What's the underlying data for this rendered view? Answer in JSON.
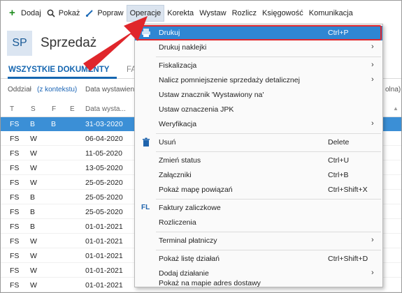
{
  "toolbar": {
    "items": [
      {
        "label": "Dodaj",
        "icon": "plus-icon"
      },
      {
        "label": "Pokaż",
        "icon": "search-icon"
      },
      {
        "label": "Popraw",
        "icon": "brush-icon"
      },
      {
        "label": "Operacje",
        "icon": ""
      },
      {
        "label": "Korekta",
        "icon": ""
      },
      {
        "label": "Wystaw",
        "icon": ""
      },
      {
        "label": "Rozlicz",
        "icon": ""
      },
      {
        "label": "Księgowość",
        "icon": ""
      },
      {
        "label": "Komunikacja",
        "icon": ""
      }
    ]
  },
  "header": {
    "badge": "SP",
    "title": "Sprzedaż"
  },
  "tabs": {
    "active": "WSZYSTKIE DOKUMENTY",
    "next": "FA"
  },
  "filters": {
    "oddzial": "Oddział",
    "kontekst": "(z kontekstu)",
    "data": "Data wystawien",
    "right": "olna)"
  },
  "grid": {
    "headers": {
      "t": "T",
      "s": "S",
      "f": "F",
      "e": "E",
      "date": "Data wysta..."
    },
    "rows": [
      {
        "t": "FS",
        "s": "B",
        "f": "B",
        "date": "31-03-2020",
        "selected": true
      },
      {
        "t": "FS",
        "s": "W",
        "f": "",
        "date": "06-04-2020"
      },
      {
        "t": "FS",
        "s": "W",
        "f": "",
        "date": "11-05-2020"
      },
      {
        "t": "FS",
        "s": "W",
        "f": "",
        "date": "13-05-2020"
      },
      {
        "t": "FS",
        "s": "W",
        "f": "",
        "date": "25-05-2020"
      },
      {
        "t": "FS",
        "s": "B",
        "f": "",
        "date": "25-05-2020"
      },
      {
        "t": "FS",
        "s": "B",
        "f": "",
        "date": "25-05-2020"
      },
      {
        "t": "FS",
        "s": "B",
        "f": "",
        "date": "01-01-2021"
      },
      {
        "t": "FS",
        "s": "W",
        "f": "",
        "date": "01-01-2021"
      },
      {
        "t": "FS",
        "s": "W",
        "f": "",
        "date": "01-01-2021"
      },
      {
        "t": "FS",
        "s": "W",
        "f": "",
        "date": "01-01-2021"
      },
      {
        "t": "FS",
        "s": "W",
        "f": "",
        "date": "01-01-2021"
      }
    ]
  },
  "menu": {
    "items": [
      {
        "label": "Drukuj",
        "shortcut": "Ctrl+P",
        "icon": "printer-icon",
        "highlight": true
      },
      {
        "label": "Drukuj naklejki",
        "submenu": true
      },
      {
        "sep": true
      },
      {
        "label": "Fiskalizacja",
        "submenu": true
      },
      {
        "label": "Nalicz pomniejszenie sprzedaży detalicznej",
        "submenu": true
      },
      {
        "label": "Ustaw znacznik 'Wystawiony na'"
      },
      {
        "label": "Ustaw oznaczenia JPK"
      },
      {
        "label": "Weryfikacja",
        "submenu": true
      },
      {
        "sep": true
      },
      {
        "label": "Usuń",
        "shortcut": "Delete",
        "icon": "trash-icon"
      },
      {
        "sep": true
      },
      {
        "label": "Zmień status",
        "shortcut": "Ctrl+U"
      },
      {
        "label": "Załączniki",
        "shortcut": "Ctrl+B"
      },
      {
        "label": "Pokaż mapę powiązań",
        "shortcut": "Ctrl+Shift+X"
      },
      {
        "sep": true
      },
      {
        "label": "Faktury zaliczkowe",
        "icon": "fl-icon",
        "icon_text": "FL"
      },
      {
        "label": "Rozliczenia"
      },
      {
        "sep": true
      },
      {
        "label": "Terminal płatniczy",
        "submenu": true
      },
      {
        "sep": true
      },
      {
        "label": "Pokaż listę działań",
        "shortcut": "Ctrl+Shift+D"
      },
      {
        "label": "Dodaj działanie",
        "submenu": true
      },
      {
        "label": "Pokaż na mapie adres dostawy"
      }
    ]
  },
  "colors": {
    "accent": "#2f86d3",
    "highlight_ring": "#e0262b",
    "arrow": "#e0262b",
    "selected_row": "#3b8fd6"
  }
}
